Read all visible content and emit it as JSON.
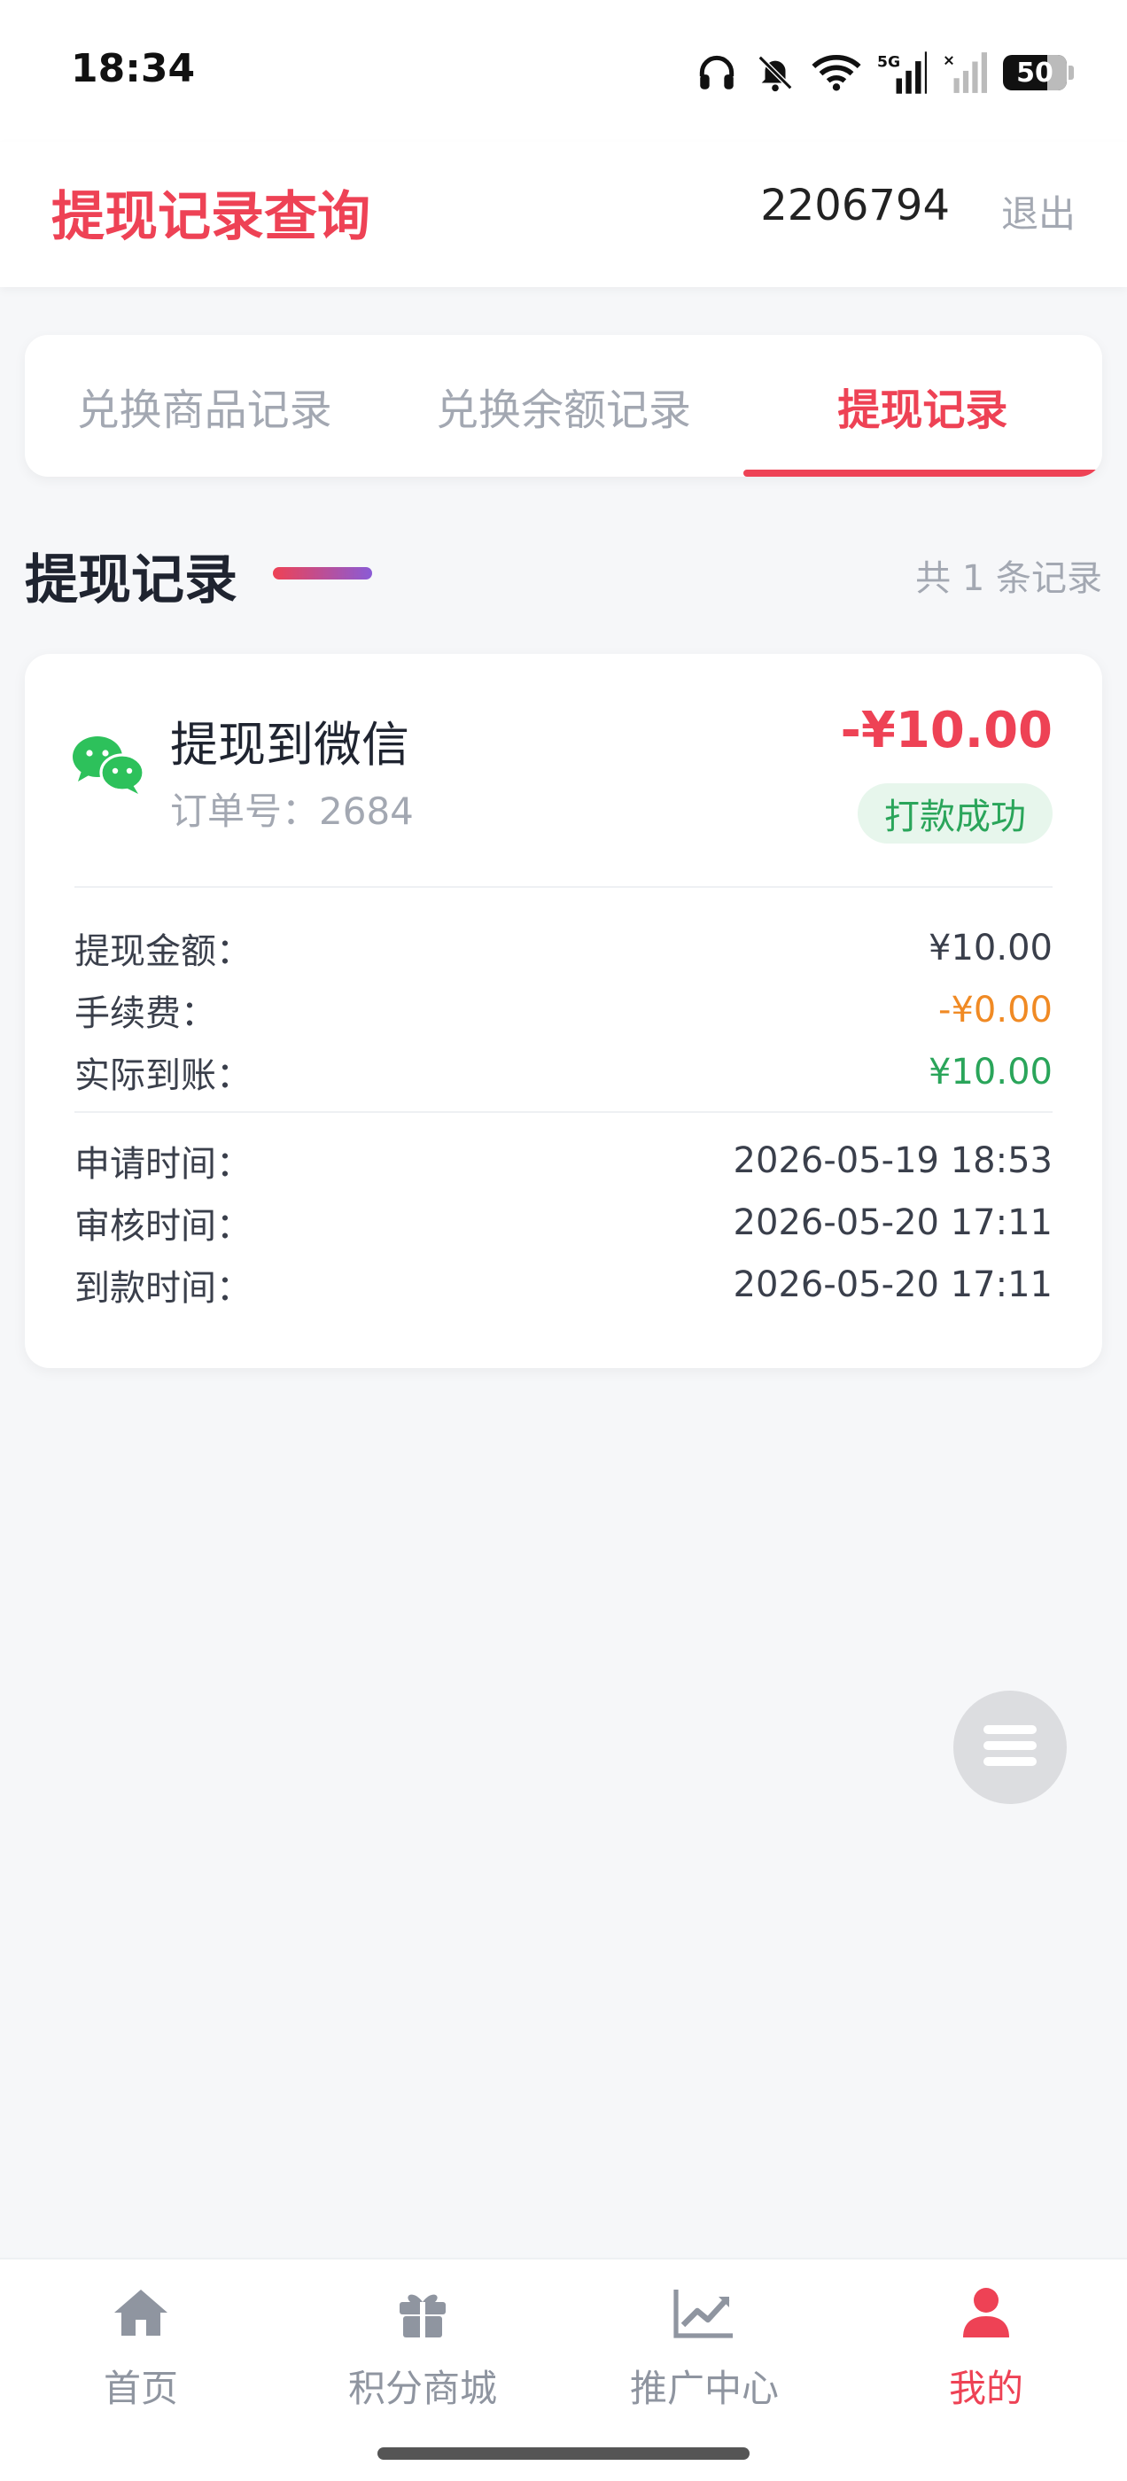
{
  "status_bar": {
    "time": "18:34",
    "battery_level": "50",
    "network": "5G",
    "icons": [
      "headphones-icon",
      "bell-muted-icon",
      "wifi-icon",
      "signal-5g-icon",
      "signal-off-icon",
      "battery-icon"
    ]
  },
  "header": {
    "title": "提现记录查询",
    "user_id": "2206794",
    "logout_label": "退出"
  },
  "tabs": [
    {
      "label": "兑换商品记录",
      "active": false
    },
    {
      "label": "兑换余额记录",
      "active": false
    },
    {
      "label": "提现记录",
      "active": true
    }
  ],
  "section": {
    "title": "提现记录",
    "count_text": "共 1 条记录"
  },
  "record": {
    "icon": "wechat-icon",
    "title": "提现到微信",
    "order_number": "订单号：2684",
    "amount": "-¥10.00",
    "status": "打款成功",
    "details": [
      {
        "label": "提现金额：",
        "value": "¥10.00"
      },
      {
        "label": "手续费：",
        "value": "-¥0.00"
      },
      {
        "label": "实际到账：",
        "value": "¥10.00"
      }
    ],
    "times": [
      {
        "label": "申请时间：",
        "value": "2026-05-19 18:53"
      },
      {
        "label": "审核时间：",
        "value": "2026-05-20 17:11"
      },
      {
        "label": "到款时间：",
        "value": "2026-05-20 17:11"
      }
    ]
  },
  "bottom_nav": [
    {
      "label": "首页",
      "icon": "home-icon",
      "active": false
    },
    {
      "label": "积分商城",
      "icon": "gift-icon",
      "active": false
    },
    {
      "label": "推广中心",
      "icon": "chart-line-icon",
      "active": false
    },
    {
      "label": "我的",
      "icon": "user-icon",
      "active": true
    }
  ],
  "colors": {
    "accent": "#ee4255",
    "success": "#2aa55a",
    "warning": "#f08a24",
    "muted": "#a3a8b2"
  }
}
